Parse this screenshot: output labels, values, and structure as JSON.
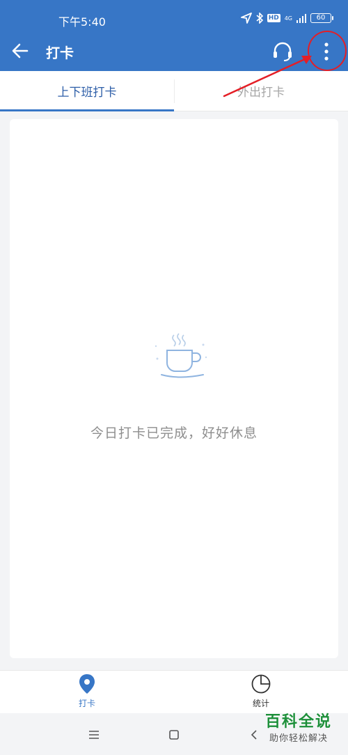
{
  "status_bar": {
    "time": "下午5:40",
    "hd_label": "HD",
    "network_label": "4G",
    "battery": "60"
  },
  "header": {
    "title": "打卡"
  },
  "tabs": [
    {
      "label": "上下班打卡",
      "active": true
    },
    {
      "label": "外出打卡",
      "active": false
    }
  ],
  "content": {
    "empty_message": "今日打卡已完成，好好休息"
  },
  "bottom_nav": {
    "items": [
      {
        "label": "打卡",
        "icon": "location-pin-icon",
        "active": true
      },
      {
        "label": "统计",
        "icon": "pie-chart-icon",
        "active": false
      }
    ]
  },
  "watermark": {
    "main": "百科全说",
    "sub": "助你轻松解决"
  },
  "colors": {
    "primary": "#3776c6",
    "annotation": "#e41e26",
    "background": "#f3f4f6"
  }
}
